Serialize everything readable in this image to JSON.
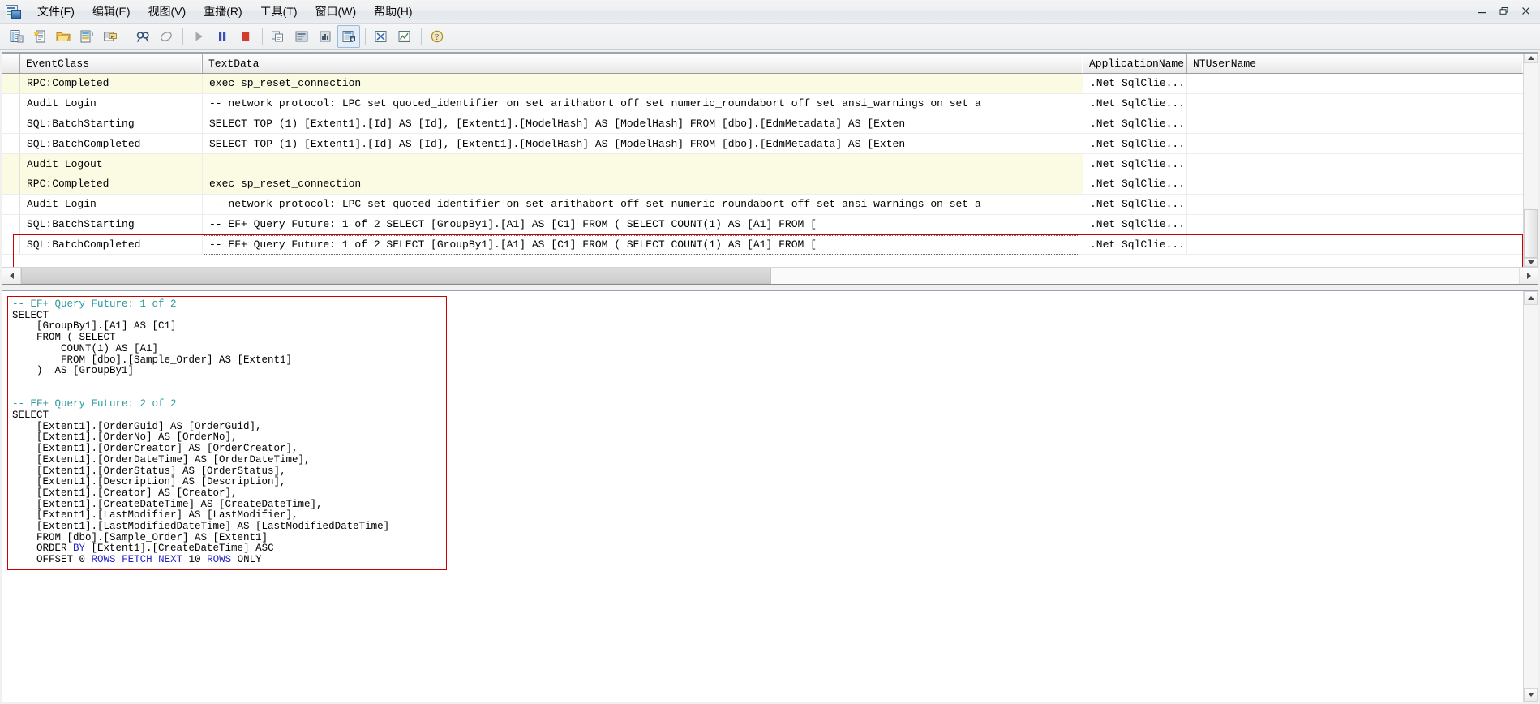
{
  "menu": {
    "app_icon": "profiler-icon",
    "items": [
      {
        "label": "文件(F)",
        "name": "menu-file"
      },
      {
        "label": "编辑(E)",
        "name": "menu-edit"
      },
      {
        "label": "视图(V)",
        "name": "menu-view"
      },
      {
        "label": "重播(R)",
        "name": "menu-replay"
      },
      {
        "label": "工具(T)",
        "name": "menu-tools"
      },
      {
        "label": "窗口(W)",
        "name": "menu-window"
      },
      {
        "label": "帮助(H)",
        "name": "menu-help"
      }
    ],
    "window_controls": {
      "minimize": "–",
      "restore": "❐",
      "close": "✕"
    }
  },
  "toolbar": {
    "buttons": [
      {
        "name": "new-trace-template-icon",
        "title": "新建跟踪模板"
      },
      {
        "name": "new-trace-icon",
        "title": "新建跟踪"
      },
      {
        "name": "open-trace-file-icon",
        "title": "打开跟踪文件"
      },
      {
        "name": "open-trace-table-icon",
        "title": "打开跟踪表"
      },
      {
        "name": "save-trace-icon",
        "title": "保存"
      },
      {
        "name": "find-icon",
        "title": "查找"
      },
      {
        "name": "clear-trace-window-icon",
        "title": "清除跟踪窗口"
      },
      {
        "name": "run-trace-icon",
        "title": "启动所选跟踪"
      },
      {
        "name": "pause-trace-icon",
        "title": "暂停所选跟踪"
      },
      {
        "name": "stop-trace-icon",
        "title": "停止所选跟踪"
      },
      {
        "name": "trace-properties-icon",
        "title": "属性"
      },
      {
        "name": "auto-scroll-icon",
        "title": "自动滚动窗口"
      },
      {
        "name": "group-columns-icon",
        "title": "分组列"
      },
      {
        "name": "show-aggregated-view-icon",
        "title": "聚合视图"
      },
      {
        "name": "query-analyzer-icon",
        "title": "查询分析器"
      },
      {
        "name": "performance-counters-icon",
        "title": "性能计数器"
      },
      {
        "name": "help-icon",
        "title": "帮助"
      }
    ]
  },
  "grid": {
    "columns": [
      "EventClass",
      "TextData",
      "ApplicationName",
      "NTUserName"
    ],
    "rows": [
      {
        "EventClass": "RPC:Completed",
        "TextData": "exec sp_reset_connection",
        "ApplicationName": ".Net SqlClie...",
        "NTUserName": "",
        "tinted": true,
        "selected": false
      },
      {
        "EventClass": "Audit Login",
        "TextData": "-- network protocol: LPC  set quoted_identifier on  set arithabort off  set numeric_roundabort off  set ansi_warnings on  set a",
        "ApplicationName": ".Net SqlClie...",
        "NTUserName": "",
        "tinted": false,
        "selected": false
      },
      {
        "EventClass": "SQL:BatchStarting",
        "TextData": "SELECT TOP (1)        [Extent1].[Id] AS [Id],         [Extent1].[ModelHash] AS [ModelHash]       FROM [dbo].[EdmMetadata] AS [Exten",
        "ApplicationName": ".Net SqlClie...",
        "NTUserName": "",
        "tinted": false,
        "selected": false
      },
      {
        "EventClass": "SQL:BatchCompleted",
        "TextData": "SELECT TOP (1)        [Extent1].[Id] AS [Id],         [Extent1].[ModelHash] AS [ModelHash]       FROM [dbo].[EdmMetadata] AS [Exten",
        "ApplicationName": ".Net SqlClie...",
        "NTUserName": "",
        "tinted": false,
        "selected": false
      },
      {
        "EventClass": "Audit Logout",
        "TextData": "",
        "ApplicationName": ".Net SqlClie...",
        "NTUserName": "",
        "tinted": true,
        "selected": false
      },
      {
        "EventClass": "RPC:Completed",
        "TextData": "exec sp_reset_connection",
        "ApplicationName": ".Net SqlClie...",
        "NTUserName": "",
        "tinted": true,
        "selected": false
      },
      {
        "EventClass": "Audit Login",
        "TextData": "-- network protocol: LPC  set quoted_identifier on  set arithabort off  set numeric_roundabort off  set ansi_warnings on  set a",
        "ApplicationName": ".Net SqlClie...",
        "NTUserName": "",
        "tinted": false,
        "selected": false
      },
      {
        "EventClass": "SQL:BatchStarting",
        "TextData": "-- EF+ Query Future: 1 of 2  SELECT         [GroupBy1].[A1] AS [C1]       FROM ( SELECT              COUNT(1) AS [A1]            FROM [",
        "ApplicationName": ".Net SqlClie...",
        "NTUserName": "",
        "tinted": false,
        "selected": true,
        "focused": true
      },
      {
        "EventClass": "SQL:BatchCompleted",
        "TextData": "-- EF+ Query Future: 1 of 2  SELECT         [GroupBy1].[A1] AS [C1]       FROM ( SELECT              COUNT(1) AS [A1]            FROM [",
        "ApplicationName": ".Net SqlClie...",
        "NTUserName": "",
        "tinted": false,
        "selected": true,
        "focused": false
      }
    ]
  },
  "detail_pane": {
    "sql_lines": [
      {
        "text": "-- EF+ Query Future: 1 of 2",
        "type": "comment"
      },
      {
        "text": "SELECT",
        "type": "plain"
      },
      {
        "text": "    [GroupBy1].[A1] AS [C1]",
        "type": "plain"
      },
      {
        "text": "    FROM ( SELECT",
        "type": "plain"
      },
      {
        "text": "        COUNT(1) AS [A1]",
        "type": "plain"
      },
      {
        "text": "        FROM [dbo].[Sample_Order] AS [Extent1]",
        "type": "plain"
      },
      {
        "text": "    )  AS [GroupBy1]",
        "type": "plain"
      },
      {
        "text": "",
        "type": "plain"
      },
      {
        "text": "",
        "type": "plain"
      },
      {
        "text": "-- EF+ Query Future: 2 of 2",
        "type": "comment"
      },
      {
        "text": "SELECT",
        "type": "plain"
      },
      {
        "text": "    [Extent1].[OrderGuid] AS [OrderGuid],",
        "type": "plain"
      },
      {
        "text": "    [Extent1].[OrderNo] AS [OrderNo],",
        "type": "plain"
      },
      {
        "text": "    [Extent1].[OrderCreator] AS [OrderCreator],",
        "type": "plain"
      },
      {
        "text": "    [Extent1].[OrderDateTime] AS [OrderDateTime],",
        "type": "plain"
      },
      {
        "text": "    [Extent1].[OrderStatus] AS [OrderStatus],",
        "type": "plain"
      },
      {
        "text": "    [Extent1].[Description] AS [Description],",
        "type": "plain"
      },
      {
        "text": "    [Extent1].[Creator] AS [Creator],",
        "type": "plain"
      },
      {
        "text": "    [Extent1].[CreateDateTime] AS [CreateDateTime],",
        "type": "plain"
      },
      {
        "text": "    [Extent1].[LastModifier] AS [LastModifier],",
        "type": "plain"
      },
      {
        "text": "    [Extent1].[LastModifiedDateTime] AS [LastModifiedDateTime]",
        "type": "plain"
      },
      {
        "text": "    FROM [dbo].[Sample_Order] AS [Extent1]",
        "type": "plain"
      },
      {
        "text": "    ORDER BY [Extent1].[CreateDateTime] ASC",
        "type": "orderby"
      },
      {
        "text": "    OFFSET 0 ROWS FETCH NEXT 10 ROWS ONLY",
        "type": "offset"
      }
    ],
    "keywords": [
      "BY",
      "ROWS",
      "FETCH",
      "NEXT"
    ]
  },
  "colors": {
    "selection_border": "#cc0000",
    "tinted_row": "#fbfbe4",
    "comment": "#2a9a9a",
    "keyword": "#2323c8",
    "header_bg": "#f0f0f0"
  }
}
